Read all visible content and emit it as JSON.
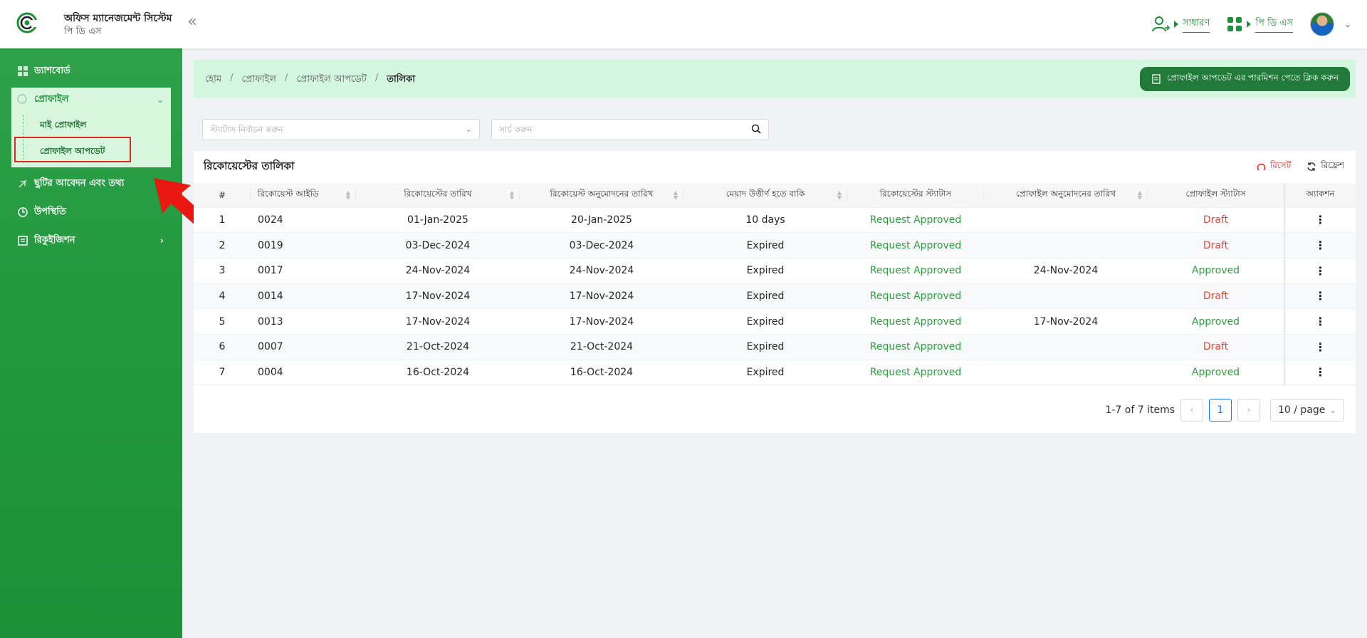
{
  "header": {
    "app_title": "অফিস ম্যানেজমেন্ট সিস্টেম",
    "app_subtitle": "পি ডি এস",
    "role_label": "সাধারণ",
    "module_label": "পি ডি এস",
    "accent": "#1f8f3a"
  },
  "sidebar": {
    "dashboard": "ড্যাশবোর্ড",
    "profile": "প্রোফাইল",
    "my_profile": "মাই প্রোফাইল",
    "profile_update": "প্রোফাইল আপডেট",
    "leave": "ছুটির আবেদন এবং তথ্য",
    "attendance": "উপস্থিতি",
    "requisition": "রিকুইজিশন"
  },
  "breadcrumb": {
    "home": "হোম",
    "profile": "প্রোফাইল",
    "profile_update": "প্রোফাইল আপডেট",
    "current": "তালিকা"
  },
  "permission_button": "প্রোফাইল আপডেট এর পারমিশন পেতে ক্লিক করুন",
  "filters": {
    "status_placeholder": "স্ট্যাটাস নির্বাচন করুন",
    "search_placeholder": "সার্চ করুন"
  },
  "card": {
    "title": "রিকোয়েস্টের তালিকা",
    "reset": "রিসেট",
    "refresh": "রিফ্রেশ"
  },
  "table": {
    "headers": [
      "#",
      "রিকোয়েস্ট আইডি",
      "রিকোয়েস্টের তারিখ",
      "রিকোয়েস্ট অনুমোদনের তারিখ",
      "মেয়াদ উত্তীর্ণ হতে বাকি",
      "রিকোয়েস্টের স্ট্যাটাস",
      "প্রোফাইল অনুমোদনের তারিখ",
      "প্রোফাইল স্ট্যাটাস",
      "অ্যাকশন"
    ],
    "rows": [
      [
        "1",
        "0024",
        "01-Jan-2025",
        "20-Jan-2025",
        "10 days",
        "Request Approved",
        "",
        "Draft",
        "⋮"
      ],
      [
        "2",
        "0019",
        "03-Dec-2024",
        "03-Dec-2024",
        "Expired",
        "Request Approved",
        "",
        "Draft",
        "⋮"
      ],
      [
        "3",
        "0017",
        "24-Nov-2024",
        "24-Nov-2024",
        "Expired",
        "Request Approved",
        "24-Nov-2024",
        "Approved",
        "⋮"
      ],
      [
        "4",
        "0014",
        "17-Nov-2024",
        "17-Nov-2024",
        "Expired",
        "Request Approved",
        "",
        "Draft",
        "⋮"
      ],
      [
        "5",
        "0013",
        "17-Nov-2024",
        "17-Nov-2024",
        "Expired",
        "Request Approved",
        "17-Nov-2024",
        "Approved",
        "⋮"
      ],
      [
        "6",
        "0007",
        "21-Oct-2024",
        "21-Oct-2024",
        "Expired",
        "Request Approved",
        "",
        "Draft",
        "⋮"
      ],
      [
        "7",
        "0004",
        "16-Oct-2024",
        "16-Oct-2024",
        "Expired",
        "Request Approved",
        "",
        "Approved",
        "⋮"
      ]
    ]
  },
  "pagination": {
    "summary": "1-7 of 7 items",
    "current_page": "1",
    "page_size": "10 / page"
  }
}
